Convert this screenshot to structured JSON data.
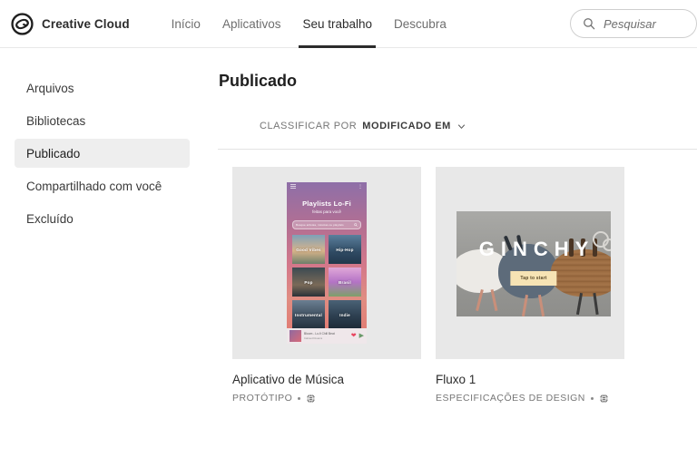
{
  "header": {
    "brand_name": "Creative Cloud",
    "logo_icon": "creative-cloud-logo",
    "nav": [
      {
        "label": "Início",
        "active": false
      },
      {
        "label": "Aplicativos",
        "active": false
      },
      {
        "label": "Seu trabalho",
        "active": true
      },
      {
        "label": "Descubra",
        "active": false
      }
    ],
    "search": {
      "placeholder": "Pesquisar",
      "value": "",
      "icon": "search-icon"
    }
  },
  "sidebar": {
    "items": [
      {
        "label": "Arquivos",
        "selected": false
      },
      {
        "label": "Bibliotecas",
        "selected": false
      },
      {
        "label": "Publicado",
        "selected": true
      },
      {
        "label": "Compartilhado com você",
        "selected": false
      },
      {
        "label": "Excluído",
        "selected": false
      }
    ]
  },
  "main": {
    "page_title": "Publicado",
    "sort": {
      "label": "CLASSIFICAR POR",
      "value": "MODIFICADO EM",
      "chevron_icon": "chevron-down-icon"
    },
    "cards": [
      {
        "title": "Aplicativo de Música",
        "meta_type": "PROTÓTIPO",
        "meta_icon": "globe-icon",
        "thumbnail": {
          "kind": "phone-mockup",
          "heading": "Playlists Lo-Fi",
          "subheading": "feitas para você",
          "search_placeholder": "Busque artistas, músicas ou playlists",
          "tiles": [
            "Good Vibes",
            "Hip-Hop",
            "Pop",
            "Brasil",
            "Instrumental",
            "Indie"
          ],
          "player_track": "Bloom - Lo-fi Chill Beat",
          "player_artist": "Calmed Dreams",
          "player_icons": [
            "heart-icon",
            "play-icon"
          ]
        }
      },
      {
        "title": "Fluxo 1",
        "meta_type": "ESPECIFICAÇÕES DE DESIGN",
        "meta_icon": "globe-icon",
        "thumbnail": {
          "kind": "ginchy-hero",
          "heading": "GINCHY",
          "button_label": "Tap to start"
        }
      }
    ]
  },
  "colors": {
    "accent_underline": "#2c2c2c",
    "sidebar_selected_bg": "#eeeeee",
    "card_bg": "#e8e8e8",
    "text_primary": "#2c2c2c",
    "text_muted": "#767676"
  }
}
